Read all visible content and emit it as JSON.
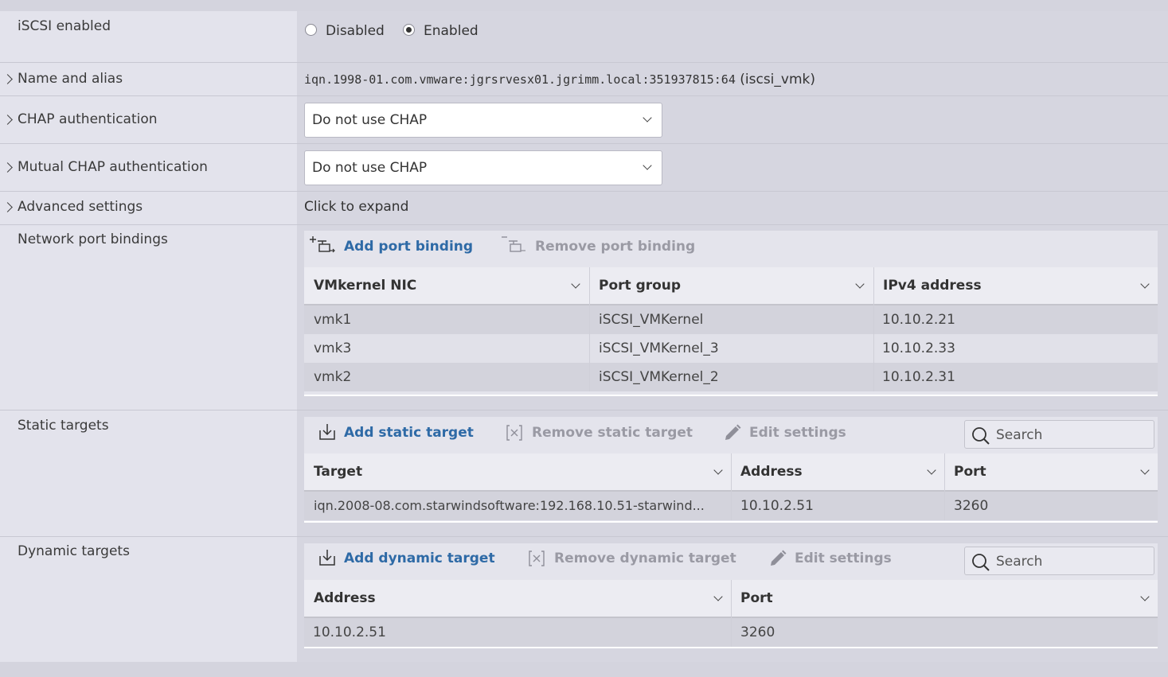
{
  "settings": {
    "iscsi_enabled": {
      "label": "iSCSI enabled",
      "options": [
        "Disabled",
        "Enabled"
      ],
      "selected": "Enabled"
    },
    "name_alias": {
      "label": "Name and alias",
      "iqn": "iqn.1998-01.com.vmware:jgrsrvesx01.jgrimm.local:351937815:64",
      "alias": "(iscsi_vmk)"
    },
    "chap": {
      "label": "CHAP authentication",
      "value": "Do not use CHAP"
    },
    "mutual_chap": {
      "label": "Mutual CHAP authentication",
      "value": "Do not use CHAP"
    },
    "advanced": {
      "label": "Advanced settings",
      "value": "Click to expand"
    }
  },
  "port_bindings": {
    "label": "Network port bindings",
    "add_label": "Add port binding",
    "remove_label": "Remove port binding",
    "columns": [
      "VMkernel NIC",
      "Port group",
      "IPv4 address"
    ],
    "rows": [
      [
        "vmk1",
        "iSCSI_VMKernel",
        "10.10.2.21"
      ],
      [
        "vmk3",
        "iSCSI_VMKernel_3",
        "10.10.2.33"
      ],
      [
        "vmk2",
        "iSCSI_VMKernel_2",
        "10.10.2.31"
      ]
    ]
  },
  "static_targets": {
    "label": "Static targets",
    "add_label": "Add static target",
    "remove_label": "Remove static target",
    "edit_label": "Edit settings",
    "search_placeholder": "Search",
    "columns": [
      "Target",
      "Address",
      "Port"
    ],
    "rows": [
      [
        "iqn.2008-08.com.starwindsoftware:192.168.10.51-starwind...",
        "10.10.2.51",
        "3260"
      ]
    ]
  },
  "dynamic_targets": {
    "label": "Dynamic targets",
    "add_label": "Add dynamic target",
    "remove_label": "Remove dynamic target",
    "edit_label": "Edit settings",
    "search_placeholder": "Search",
    "columns": [
      "Address",
      "Port"
    ],
    "rows": [
      [
        "10.10.2.51",
        "3260"
      ]
    ]
  },
  "colors": {
    "accent": "#2e6aa6",
    "disabled": "#9a9aa4"
  }
}
